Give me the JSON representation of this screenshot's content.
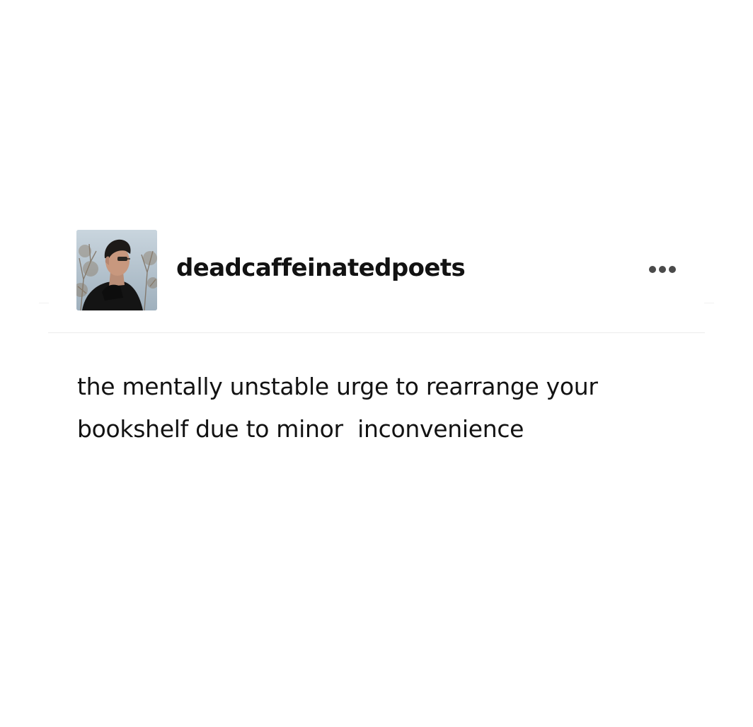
{
  "post": {
    "username": "deadcaffeinatedpoets",
    "avatar_icon": "avatar-photo-icon",
    "menu_icon": "more-options-icon",
    "body_lines": [
      "the mentally unstable urge to rearrange your",
      "bookshelf due to minor  inconvenience"
    ]
  }
}
